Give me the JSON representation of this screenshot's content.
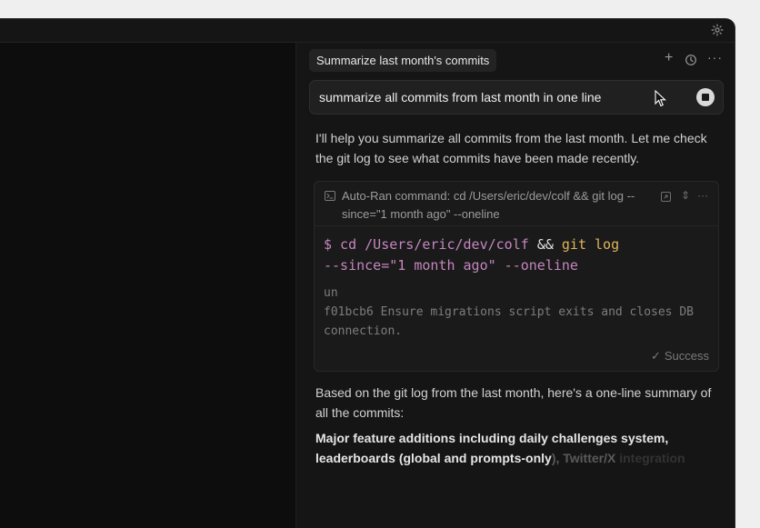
{
  "header": {
    "tab_title": "Summarize last month's commits",
    "icons": [
      "plus-icon",
      "history-icon",
      "more-icon",
      "gear-icon"
    ]
  },
  "prompt": {
    "text": "summarize all commits from last month in one line"
  },
  "messages": {
    "intro": "I'll help you summarize all commits from the last month. Let me check the git log to see what commits have been made recently.",
    "followup": "Based on the git log from the last month, here's a one-line summary of all the commits:",
    "summary_bold": "Major feature additions including daily challenges system, leaderboards (global and prompts-only",
    "summary_fade": "), Twitter/X",
    "summary_fade2": " integration"
  },
  "command_card": {
    "summary": "Auto-Ran command: cd /Users/eric/dev/colf && git log --since=\"1 month ago\" --oneline",
    "cmd_prompt": "$ cd /Users/eric/dev/colf ",
    "cmd_amp": "&&",
    "cmd_git": " git log",
    "cmd_args": "--since=\"1 month ago\" --oneline",
    "output": [
      "un",
      "f01bcb6 Ensure migrations script exits and closes DB connection."
    ],
    "status": "Success"
  },
  "colors": {
    "background": "#0f0f0f",
    "panel": "#151515",
    "accent_command": "#c586c0",
    "accent_keyword": "#e0b45a"
  }
}
